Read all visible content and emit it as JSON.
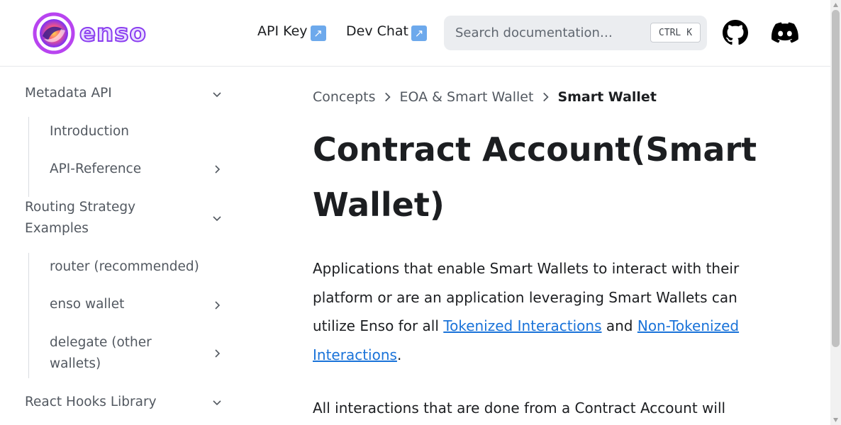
{
  "brand": {
    "name": "enso"
  },
  "nav": {
    "api_key": "API Key",
    "dev_chat": "Dev Chat",
    "ext_glyph": "↗"
  },
  "search": {
    "placeholder": "Search documentation…",
    "kbd_ctrl": "CTRL",
    "kbd_k": "K"
  },
  "icons": {
    "github": "github-icon",
    "discord": "discord-icon"
  },
  "sidebar": {
    "items": [
      {
        "label": "Metadata API",
        "caret": "down"
      },
      {
        "label": "Introduction"
      },
      {
        "label": "API-Reference",
        "caret": "right"
      },
      {
        "label": "Routing Strategy Examples",
        "caret": "down"
      },
      {
        "label": "router (recommended)"
      },
      {
        "label": "enso wallet",
        "caret": "right"
      },
      {
        "label": "delegate (other wallets)",
        "caret": "right"
      },
      {
        "label": "React Hooks Library",
        "caret": "down"
      }
    ]
  },
  "breadcrumb": {
    "item1": "Concepts",
    "item2": "EOA & Smart Wallet",
    "current": "Smart Wallet"
  },
  "article": {
    "title": "Contract Account(Smart Wallet)",
    "p1_text1": "Applications that enable Smart Wallets to interact with their platform or are an application leveraging Smart Wallets can utilize Enso for all ",
    "p1_link1": "Tokenized Interactions",
    "p1_text2": " and ",
    "p1_link2": "Non-Tokenized Interactions",
    "p1_text3": ".",
    "p2_text": "All interactions that are done from a Contract Account will"
  },
  "colors": {
    "link": "#1a73d9",
    "text": "#1c1e21",
    "muted": "#525860",
    "search_bg": "#ebedf0"
  }
}
